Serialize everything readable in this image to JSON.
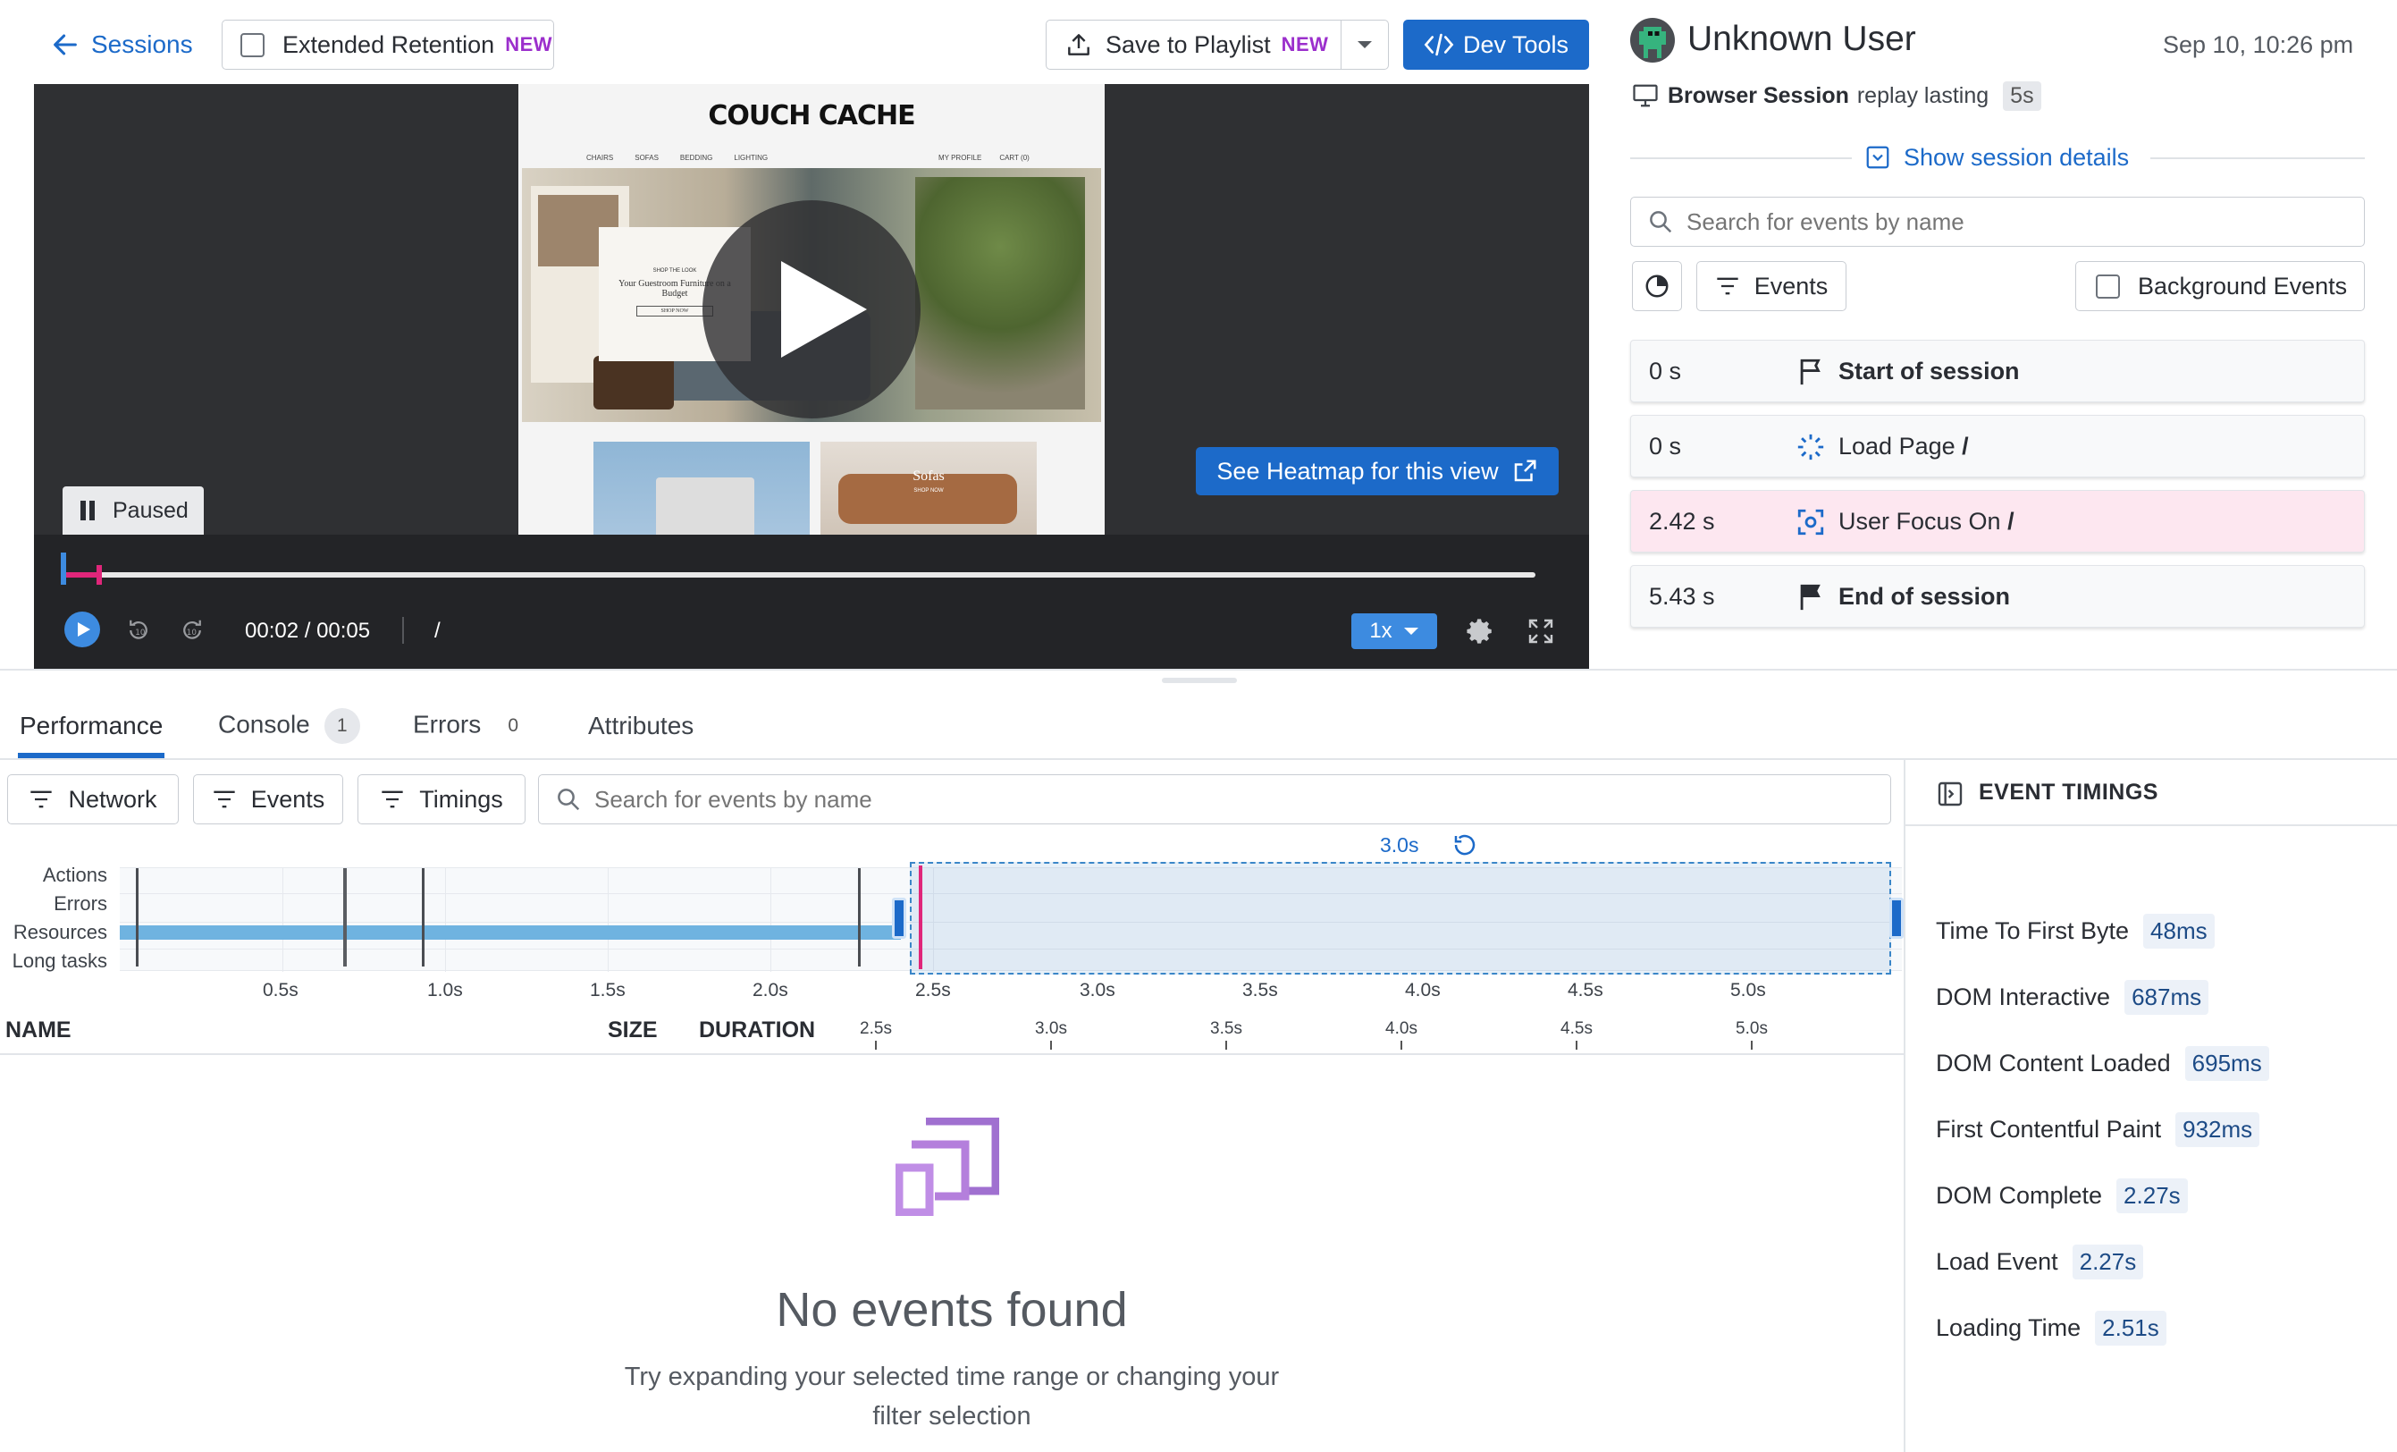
{
  "header": {
    "back_label": "Sessions",
    "extended_retention_label": "Extended Retention",
    "new_badge": "NEW",
    "save_playlist_label": "Save to Playlist",
    "save_new_badge": "NEW",
    "dev_tools_label": "Dev Tools"
  },
  "player": {
    "site_logo": "COUCH CACHE",
    "site_nav": [
      "CHAIRS",
      "SOFAS",
      "BEDDING",
      "LIGHTING"
    ],
    "site_nav_right": [
      "MY PROFILE",
      "CART (0)"
    ],
    "hero_small": "SHOP THE LOOK",
    "hero_title": "Your Guestroom Furniture on a Budget",
    "hero_btn": "SHOP NOW",
    "tile_label": "Sofas",
    "tile_sub": "SHOP NOW",
    "heatmap_label": "See Heatmap for this view",
    "paused_label": "Paused",
    "time_display": "00:02 / 00:05",
    "path_display": "/",
    "speed_label": "1x",
    "progress": 0.025
  },
  "session": {
    "user_name": "Unknown User",
    "date": "Sep 10, 10:26 pm",
    "type_label": "Browser Session",
    "replay_text": "replay lasting",
    "duration": "5s",
    "show_details": "Show session details",
    "search_placeholder": "Search for events by name",
    "events_filter_label": "Events",
    "background_events_label": "Background Events",
    "events": [
      {
        "time": "0 s",
        "label": "Start of session",
        "bold": true,
        "icon": "flag-outline-icon"
      },
      {
        "time": "0 s",
        "label": "Load Page",
        "path": "/",
        "bold": false,
        "icon": "loading-spinner-icon"
      },
      {
        "time": "2.42 s",
        "label": "User Focus On",
        "path": "/",
        "bold": false,
        "icon": "focus-target-icon",
        "highlight": "#fde7f0"
      },
      {
        "time": "5.43 s",
        "label": "End of session",
        "bold": true,
        "icon": "flag-filled-icon"
      }
    ]
  },
  "bottom": {
    "tabs": [
      {
        "label": "Performance",
        "active": true
      },
      {
        "label": "Console",
        "count": "1"
      },
      {
        "label": "Errors",
        "count": "0"
      },
      {
        "label": "Attributes"
      }
    ],
    "filters": [
      "Network",
      "Events",
      "Timings"
    ],
    "search_placeholder": "Search for events by name",
    "selection_label": "3.0s",
    "row_labels": [
      "Actions",
      "Errors",
      "Resources",
      "Long tasks"
    ],
    "axis_ticks": [
      "0.5s",
      "1.0s",
      "1.5s",
      "2.0s",
      "2.5s",
      "3.0s",
      "3.5s",
      "4.0s",
      "4.5s",
      "5.0s"
    ],
    "table_headers": {
      "name": "NAME",
      "size": "SIZE",
      "duration": "DURATION"
    },
    "table_ticks": [
      "2.5s",
      "3.0s",
      "3.5s",
      "4.0s",
      "4.5s",
      "5.0s"
    ],
    "empty_title": "No events found",
    "empty_line1": "Try expanding your selected time range or changing your",
    "empty_line2": "filter selection"
  },
  "timings": {
    "title": "EVENT TIMINGS",
    "items": [
      {
        "label": "Time To First Byte",
        "value": "48ms"
      },
      {
        "label": "DOM Interactive",
        "value": "687ms"
      },
      {
        "label": "DOM Content Loaded",
        "value": "695ms"
      },
      {
        "label": "First Contentful Paint",
        "value": "932ms"
      },
      {
        "label": "DOM Complete",
        "value": "2.27s"
      },
      {
        "label": "Load Event",
        "value": "2.27s"
      },
      {
        "label": "Loading Time",
        "value": "2.51s"
      }
    ]
  },
  "colors": {
    "accent": "#1c6ac9",
    "new_badge": "#9b2fcc",
    "player_bg": "#2f3033",
    "resource_bar": "#6fb3e0",
    "selection_marker": "#e0267a"
  }
}
